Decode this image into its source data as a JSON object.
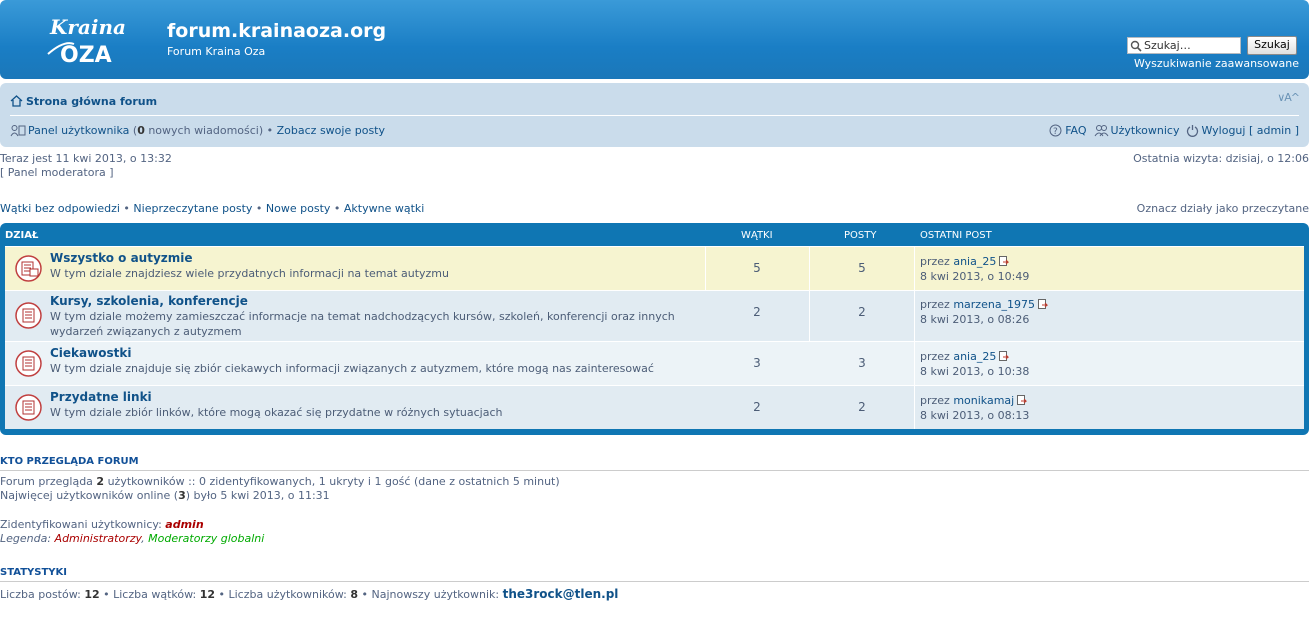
{
  "header": {
    "site_title": "forum.krainaoza.org",
    "site_description": "Forum Kraina Oza",
    "logo_text_top": "Kraina",
    "logo_text_bottom": "OZA",
    "search_placeholder": "Szukaj…",
    "search_button": "Szukaj",
    "advanced_search": "Wyszukiwanie zaawansowane"
  },
  "navbar": {
    "home": "Strona główna forum",
    "font_size": "∨A^",
    "ucp_label": "Panel użytkownika",
    "ucp_count_open": " (",
    "ucp_count": "0",
    "ucp_count_text": " nowych wiadomości)",
    "bullet": " • ",
    "own_posts": "Zobacz swoje posty",
    "faq": "FAQ",
    "members": "Użytkownicy",
    "logout": "Wyloguj [ admin ]"
  },
  "info": {
    "current_time": "Teraz jest 11 kwi 2013, o 13:32",
    "moderator_panel": "[ Panel moderatora ]",
    "last_visit": "Ostatnia wizyta: dzisiaj, o 12:06"
  },
  "quick_links": {
    "unanswered": "Wątki bez odpowiedzi",
    "unread": "Nieprzeczytane posty",
    "new_posts": "Nowe posty",
    "active": "Aktywne wątki",
    "mark_read": "Oznacz działy jako przeczytane",
    "sep": " • "
  },
  "forum_table": {
    "headers": {
      "forum": "Dział",
      "topics": "Wątki",
      "posts": "Posty",
      "last_post": "Ostatni post"
    },
    "rows": [
      {
        "title": "Wszystko o autyzmie",
        "desc": "W tym dziale znajdziesz wiele przydatnych informacji na temat autyzmu",
        "topics": "5",
        "posts": "5",
        "by": "przez ",
        "author": "ania_25",
        "date": "8 kwi 2013, o 10:49"
      },
      {
        "title": "Kursy, szkolenia, konferencje",
        "desc": "W tym dziale możemy zamieszczać informacje na temat nadchodzących kursów, szkoleń, konferencji oraz innych wydarzeń związanych z autyzmem",
        "topics": "2",
        "posts": "2",
        "by": "przez ",
        "author": "marzena_1975",
        "date": "8 kwi 2013, o 08:26"
      },
      {
        "title": "Ciekawostki",
        "desc": "W tym dziale znajduje się zbiór ciekawych informacji związanych z autyzmem, które mogą nas zainteresować",
        "topics": "3",
        "posts": "3",
        "by": "przez ",
        "author": "ania_25",
        "date": "8 kwi 2013, o 10:38"
      },
      {
        "title": "Przydatne linki",
        "desc": "W tym dziale zbiór linków, które mogą okazać się przydatne w różnych sytuacjach",
        "topics": "2",
        "posts": "2",
        "by": "przez ",
        "author": "monikamaj",
        "date": "8 kwi 2013, o 08:13"
      }
    ]
  },
  "who_is_online": {
    "heading": "KTO PRZEGLĄDA FORUM",
    "line1_a": "Forum przegląda ",
    "line1_count": "2",
    "line1_b": " użytkowników :: 0 zidentyfikowanych, 1 ukryty i 1 gość (dane z ostatnich 5 minut)",
    "line2_a": "Najwięcej użytkowników online (",
    "line2_count": "3",
    "line2_b": ") było 5 kwi 2013, o 11:31",
    "registered_label": "Zidentyfikowani użytkownicy: ",
    "registered_user": "admin",
    "legend_label": "Legenda: ",
    "legend_admins": "Administratorzy",
    "legend_comma": ", ",
    "legend_mods": "Moderatorzy globalni"
  },
  "statistics": {
    "heading": "STATYSTYKI",
    "posts_label": "Liczba postów: ",
    "posts": "12",
    "topics_label": " • Liczba wątków: ",
    "topics": "12",
    "users_label": " • Liczba użytkowników: ",
    "users": "8",
    "newest_label": " • Najnowszy użytkownik: ",
    "newest": "the3rock@tlen.pl"
  },
  "colors": {
    "header_blue": "#1a7ec5",
    "navbar_bg": "#cadceb",
    "forum_box": "#0f76b3",
    "admin_red": "#aa0000",
    "mod_green": "#00aa00",
    "link": "#105289"
  }
}
